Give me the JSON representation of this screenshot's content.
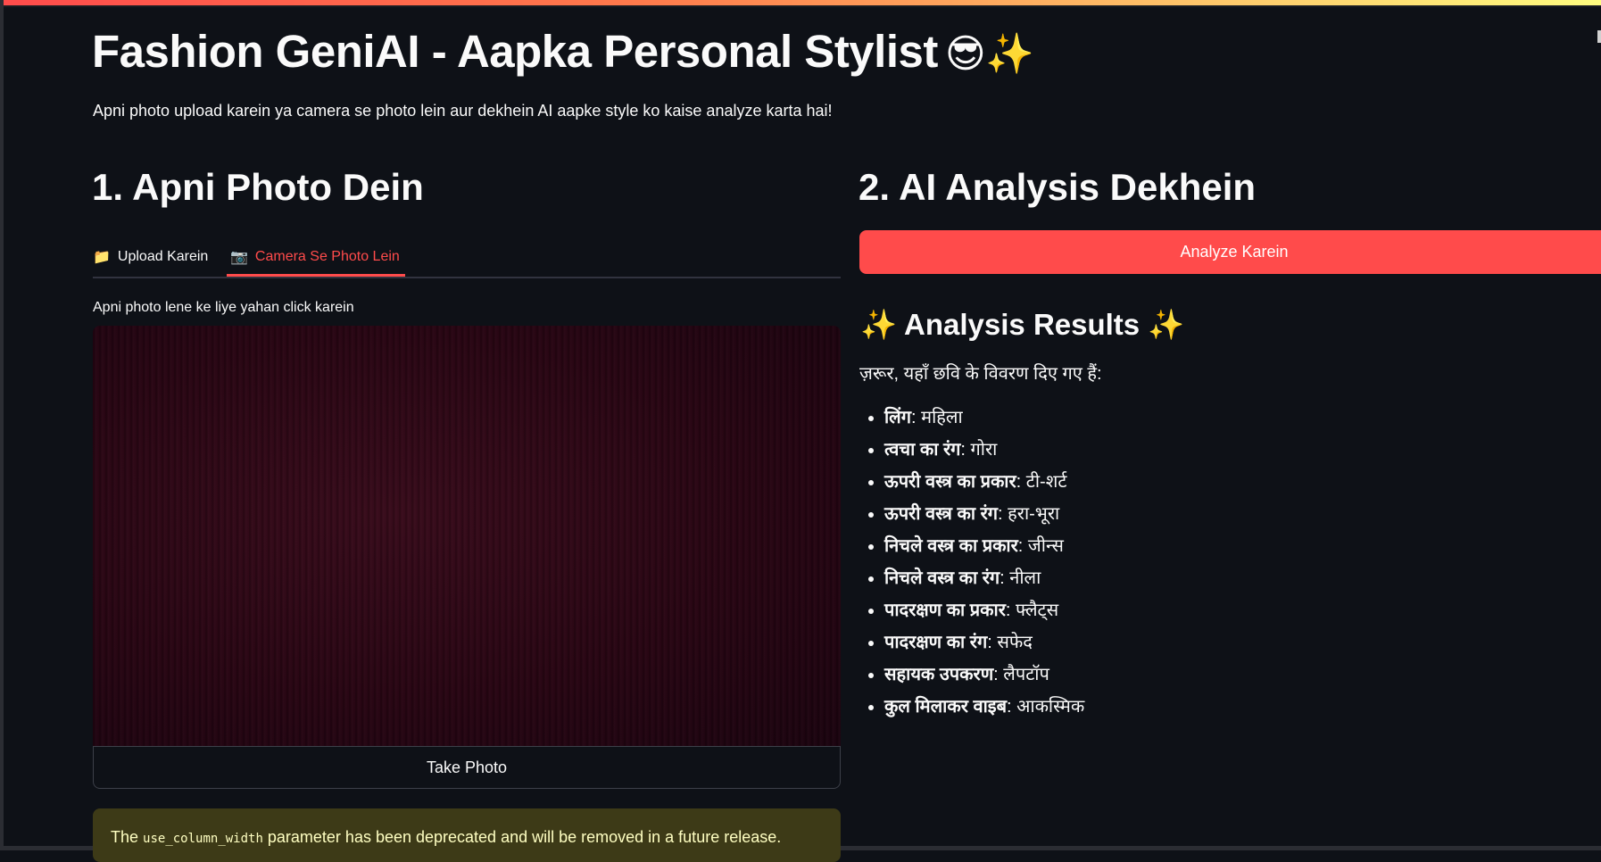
{
  "header": {
    "title": "Fashion GeniAI - Aapka Personal Stylist",
    "title_emoji": "😎✨",
    "subtitle": "Apni photo upload karein ya camera se photo lein aur dekhein AI aapke style ko kaise analyze karta hai!"
  },
  "left": {
    "heading": "1. Apni Photo Dein",
    "tabs": [
      {
        "icon": "📁",
        "icon_name": "folder-icon",
        "label": "Upload Karein",
        "active": false
      },
      {
        "icon": "📷",
        "icon_name": "camera-icon",
        "label": "Camera Se Photo Lein",
        "active": true
      }
    ],
    "camera_label": "Apni photo lene ke liye yahan click karein",
    "take_photo_label": "Take Photo",
    "warning": {
      "prefix": "The ",
      "code": "use_column_width",
      "suffix": " parameter has been deprecated and will be removed in a future release."
    }
  },
  "right": {
    "heading": "2. AI Analysis Dekhein",
    "analyze_button": "Analyze Karein",
    "results_title": "✨ Analysis Results ✨",
    "results_intro": "ज़रूर, यहाँ छवि के विवरण दिए गए हैं:",
    "results": [
      {
        "key": "लिंग",
        "value": "महिला"
      },
      {
        "key": "त्वचा का रंग",
        "value": "गोरा"
      },
      {
        "key": "ऊपरी वस्त्र का प्रकार",
        "value": "टी-शर्ट"
      },
      {
        "key": "ऊपरी वस्त्र का रंग",
        "value": "हरा-भूरा"
      },
      {
        "key": "निचले वस्त्र का प्रकार",
        "value": "जीन्स"
      },
      {
        "key": "निचले वस्त्र का रंग",
        "value": "नीला"
      },
      {
        "key": "पादरक्षण का प्रकार",
        "value": "फ्लैट्स"
      },
      {
        "key": "पादरक्षण का रंग",
        "value": "सफेद"
      },
      {
        "key": "सहायक उपकरण",
        "value": "लैपटॉप"
      },
      {
        "key": "कुल मिलाकर वाइब",
        "value": "आकस्मिक"
      }
    ]
  },
  "colors": {
    "background": "#0e1117",
    "accent": "#ff4b4b",
    "warning_bg": "#3d3a17",
    "warning_text": "#ffffc2"
  }
}
